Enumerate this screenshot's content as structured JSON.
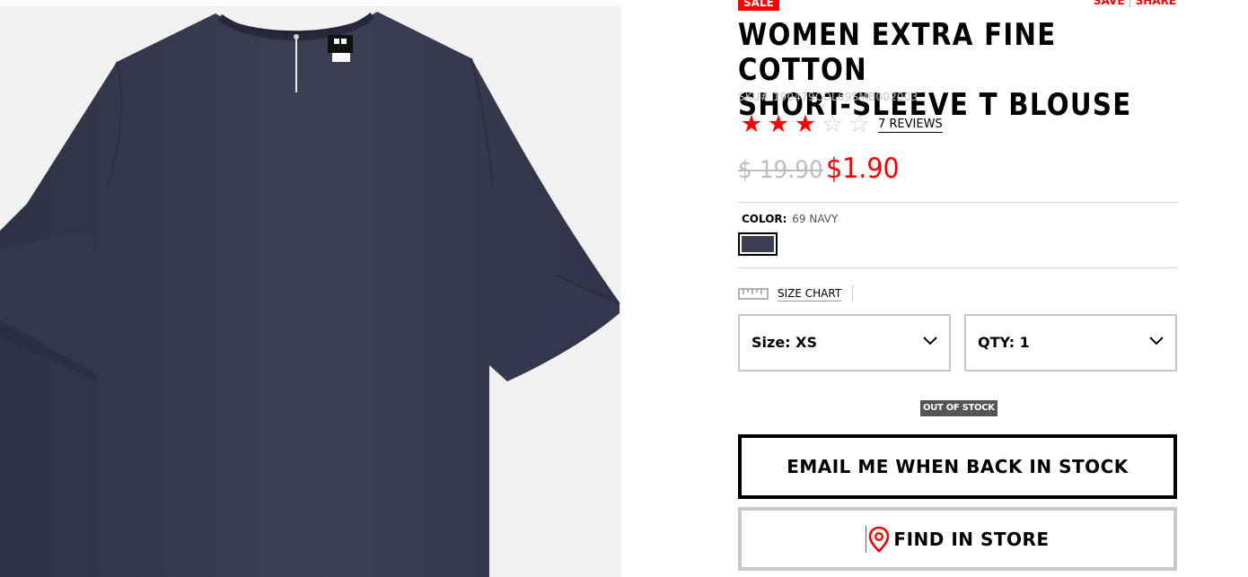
{
  "badges": {
    "sale": "SALE",
    "out_of_stock": "OUT OF STOCK"
  },
  "top_links": {
    "save": "SAVE",
    "share": "SHARE"
  },
  "product": {
    "title_line1": "WOMEN EXTRA FINE COTTON",
    "title_line2": "SHORT-SLEEVE T BLOUSE",
    "sku": "SKU# 190479COL69SMB002003",
    "rating_stars": 3,
    "rating_max": 5,
    "reviews_link": "7 REVIEWS",
    "price_original": "$ 19.90",
    "price_sale": "$1.90",
    "image_alt": "navy short-sleeve blouse",
    "garment_color": "#3b3d51"
  },
  "color": {
    "label": "COLOR:",
    "value": "69 NAVY",
    "swatch_hex": "#3b3d51"
  },
  "size_chart": {
    "link": "SIZE CHART"
  },
  "selects": {
    "size": "Size: XS",
    "qty": "QTY: 1"
  },
  "buttons": {
    "email": "EMAIL ME WHEN BACK IN STOCK",
    "find_in_store": "FIND IN STORE"
  },
  "colors": {
    "accent": "#ff0000",
    "text": "#000000",
    "muted": "#c6c6c6",
    "border": "#c8c8c8",
    "image_bg": "#f1f1f1"
  },
  "icons": {
    "star_filled": "star-filled-icon",
    "star_empty": "star-empty-icon",
    "ruler": "ruler-icon",
    "chevron": "chevron-down-icon",
    "pin": "location-pin-icon"
  }
}
